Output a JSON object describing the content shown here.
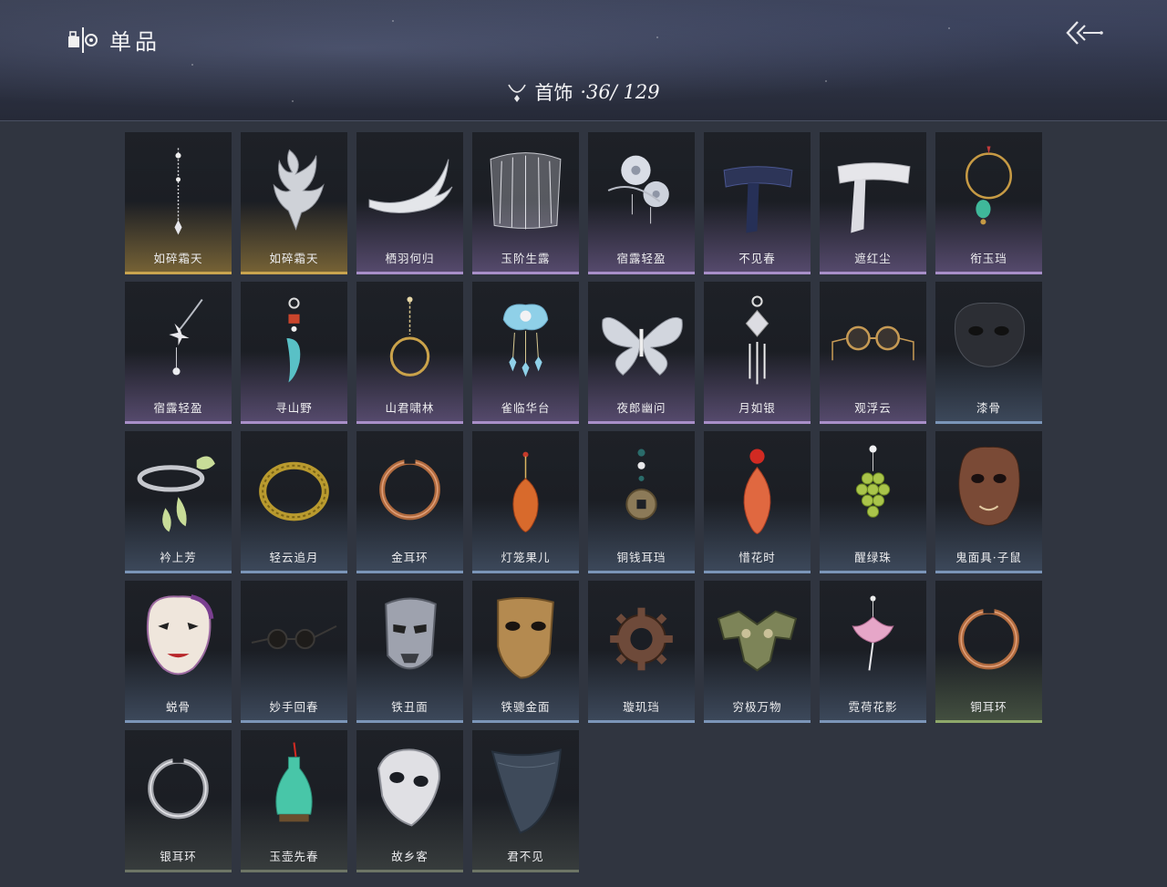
{
  "header": {
    "title": "单品",
    "category": "首饰",
    "count_text": "·36/ 129"
  },
  "items": [
    {
      "name": "如碎霜天",
      "rarity": "gold",
      "art": "chain-pendant"
    },
    {
      "name": "如碎霜天",
      "rarity": "gold",
      "art": "flame-crest"
    },
    {
      "name": "栖羽何归",
      "rarity": "purple",
      "art": "feather-band"
    },
    {
      "name": "玉阶生露",
      "rarity": "purple",
      "art": "bead-veil"
    },
    {
      "name": "宿露轻盈",
      "rarity": "purple",
      "art": "flower-hairpin"
    },
    {
      "name": "不见春",
      "rarity": "purple",
      "art": "dark-blindfold"
    },
    {
      "name": "遮红尘",
      "rarity": "purple",
      "art": "white-blindfold"
    },
    {
      "name": "衔玉珰",
      "rarity": "purple",
      "art": "jade-hoop"
    },
    {
      "name": "宿露轻盈",
      "rarity": "purple",
      "art": "branch-earring"
    },
    {
      "name": "寻山野",
      "rarity": "purple",
      "art": "tooth-earring"
    },
    {
      "name": "山君啸林",
      "rarity": "purple",
      "art": "gold-hoop"
    },
    {
      "name": "雀临华台",
      "rarity": "purple",
      "art": "cloud-tassel"
    },
    {
      "name": "夜郎幽问",
      "rarity": "purple",
      "art": "butterfly"
    },
    {
      "name": "月如银",
      "rarity": "purple",
      "art": "silver-tassel"
    },
    {
      "name": "观浮云",
      "rarity": "purple",
      "art": "round-glasses"
    },
    {
      "name": "漆骨",
      "rarity": "blue",
      "art": "dark-mask"
    },
    {
      "name": "衿上芳",
      "rarity": "blue",
      "art": "ginkgo-collar"
    },
    {
      "name": "轻云追月",
      "rarity": "blue",
      "art": "gold-torque"
    },
    {
      "name": "金耳环",
      "rarity": "blue",
      "art": "copper-ring"
    },
    {
      "name": "灯笼果儿",
      "rarity": "blue",
      "art": "lantern-fruit"
    },
    {
      "name": "铜钱耳珰",
      "rarity": "blue",
      "art": "coin-earring"
    },
    {
      "name": "惜花时",
      "rarity": "blue",
      "art": "petal-drop"
    },
    {
      "name": "醒绿珠",
      "rarity": "blue",
      "art": "grape-earring"
    },
    {
      "name": "鬼面具·子鼠",
      "rarity": "blue",
      "art": "rat-mask"
    },
    {
      "name": "蜕骨",
      "rarity": "blue",
      "art": "opera-mask"
    },
    {
      "name": "妙手回春",
      "rarity": "blue",
      "art": "small-glasses"
    },
    {
      "name": "铁丑面",
      "rarity": "blue",
      "art": "iron-mask"
    },
    {
      "name": "铁骢金面",
      "rarity": "blue",
      "art": "gold-mask"
    },
    {
      "name": "璇玑珰",
      "rarity": "blue",
      "art": "gear-ring"
    },
    {
      "name": "穷极万物",
      "rarity": "blue",
      "art": "bronze-taotie"
    },
    {
      "name": "霓荷花影",
      "rarity": "blue",
      "art": "lotus-earring"
    },
    {
      "name": "铜耳环",
      "rarity": "green",
      "art": "copper-ring"
    },
    {
      "name": "银耳环",
      "rarity": "gray",
      "art": "silver-ring"
    },
    {
      "name": "玉壶先春",
      "rarity": "gray",
      "art": "jade-vase"
    },
    {
      "name": "故乡客",
      "rarity": "gray",
      "art": "white-half-mask"
    },
    {
      "name": "君不见",
      "rarity": "gray",
      "art": "cloth-veil"
    }
  ]
}
